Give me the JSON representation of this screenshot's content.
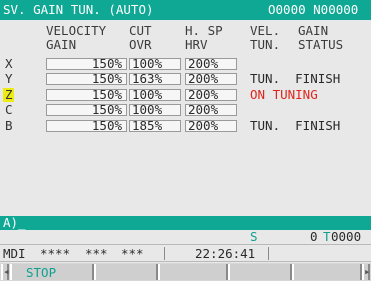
{
  "header": {
    "title": "SV. GAIN TUN. (AUTO)",
    "program": "O0000 N00000"
  },
  "columns": {
    "velocity_gain": [
      "VELOCITY",
      "GAIN"
    ],
    "cut_ovr": [
      "CUT",
      "OVR"
    ],
    "h_sp_hrv": [
      "H. SP",
      "HRV"
    ],
    "vel_tun": [
      "VEL.",
      "TUN."
    ],
    "gain_status": [
      "GAIN",
      "STATUS"
    ]
  },
  "rows": [
    {
      "axis": "X",
      "velocity_gain": "150%",
      "cut_ovr": "100%",
      "h_sp_hrv": "200%",
      "status": ""
    },
    {
      "axis": "Y",
      "velocity_gain": "150%",
      "cut_ovr": "163%",
      "h_sp_hrv": "200%",
      "status": "TUN.  FINISH"
    },
    {
      "axis": "Z",
      "velocity_gain": "150%",
      "cut_ovr": "100%",
      "h_sp_hrv": "200%",
      "status": "ON TUNING"
    },
    {
      "axis": "C",
      "velocity_gain": "150%",
      "cut_ovr": "100%",
      "h_sp_hrv": "200%",
      "status": ""
    },
    {
      "axis": "B",
      "velocity_gain": "150%",
      "cut_ovr": "185%",
      "h_sp_hrv": "200%",
      "status": "TUN.  FINISH"
    }
  ],
  "input_line": {
    "prompt": "A)_"
  },
  "status_line": {
    "s_label": "S",
    "s_value": "0",
    "t_label": "T",
    "t_value": "0000"
  },
  "mode_line": {
    "mode": "MDI",
    "status1": "****",
    "status2": "***",
    "status3": "***",
    "clock": "22:26:41"
  },
  "softkeys": {
    "key1": "STOP"
  },
  "colors": {
    "accent": "#0fa894",
    "alarm": "#e0261c",
    "highlight": "#ecec14"
  }
}
